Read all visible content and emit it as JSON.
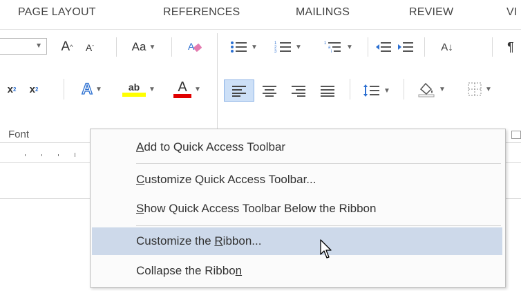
{
  "tabs": [
    "PAGE LAYOUT",
    "REFERENCES",
    "MAILINGS",
    "REVIEW",
    "VI"
  ],
  "ribbon": {
    "font_group_label": "Font",
    "grow_font": "A",
    "shrink_font": "A",
    "change_case": "Aa",
    "subscript": "x",
    "superscript": "x",
    "text_effects": "A",
    "highlight": "ab",
    "font_color": "A",
    "sort": "A↓",
    "pilcrow": "¶"
  },
  "context_menu": {
    "items": [
      {
        "pre": "",
        "key": "A",
        "post": "dd to Quick Access Toolbar"
      },
      {
        "pre": "",
        "key": "C",
        "post": "ustomize Quick Access Toolbar..."
      },
      {
        "pre": "",
        "key": "S",
        "post": "how Quick Access Toolbar Below the Ribbon"
      },
      {
        "pre": "Customize the ",
        "key": "R",
        "post": "ibbon..."
      },
      {
        "pre": "Collapse the Ribbo",
        "key": "n",
        "post": ""
      }
    ],
    "highlighted_index": 3
  },
  "colors": {
    "highlight_row": "#cdd9ea",
    "text_highlight_yellow": "#ffff00",
    "font_color_red": "#e00000",
    "accent_blue": "#2b6fd1"
  }
}
